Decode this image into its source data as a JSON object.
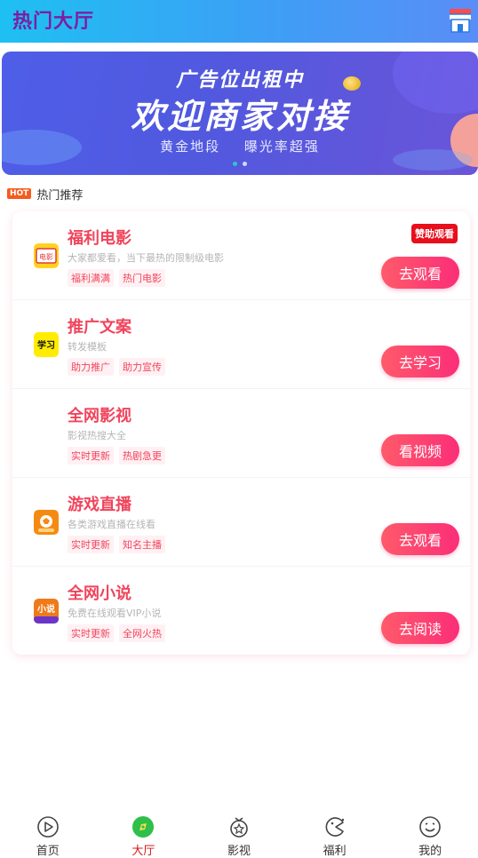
{
  "header": {
    "title": "热门大厅",
    "shop_icon": "shop-icon"
  },
  "banner": {
    "line1": "广告位出租中",
    "line2": "欢迎商家对接",
    "tagline_left": "黄金地段",
    "tagline_right": "曝光率超强",
    "colors": {
      "bg": "#4f5ee8",
      "accent": "#f3a19a"
    },
    "dots_count": 2,
    "active_dot": 0
  },
  "section": {
    "badge": "HOT",
    "title": "热门推荐"
  },
  "items": [
    {
      "name": "福利电影",
      "desc": "大家都爱看，当下最热的限制级电影",
      "tags": [
        "福利满满",
        "热门电影"
      ],
      "button": "去观看",
      "badge": "赞助观看",
      "icon": "movie-icon",
      "icon_text": "电影"
    },
    {
      "name": "推广文案",
      "desc": "转发模板",
      "tags": [
        "助力推广",
        "助力宣传"
      ],
      "button": "去学习",
      "icon": "study-icon",
      "icon_text": "学习"
    },
    {
      "name": "全网影视",
      "desc": "影视热搜大全",
      "tags": [
        "实时更新",
        "热剧急更"
      ],
      "button": "看视频",
      "icon": "video-icon",
      "icon_text": ""
    },
    {
      "name": "游戏直播",
      "desc": "各类游戏直播在线看",
      "tags": [
        "实时更新",
        "知名主播"
      ],
      "button": "去观看",
      "icon": "game-live-icon",
      "icon_text": ""
    },
    {
      "name": "全网小说",
      "desc": "免费在线观看VIP小说",
      "tags": [
        "实时更新",
        "全网火热"
      ],
      "button": "去阅读",
      "icon": "novel-icon",
      "icon_text": "小说"
    }
  ],
  "tabbar": [
    {
      "label": "首页",
      "icon": "play-circle-icon",
      "active": false
    },
    {
      "label": "大厅",
      "icon": "hall-icon",
      "active": true
    },
    {
      "label": "影视",
      "icon": "film-icon",
      "active": false
    },
    {
      "label": "福利",
      "icon": "gift-face-icon",
      "active": false
    },
    {
      "label": "我的",
      "icon": "smile-icon",
      "active": false
    }
  ]
}
